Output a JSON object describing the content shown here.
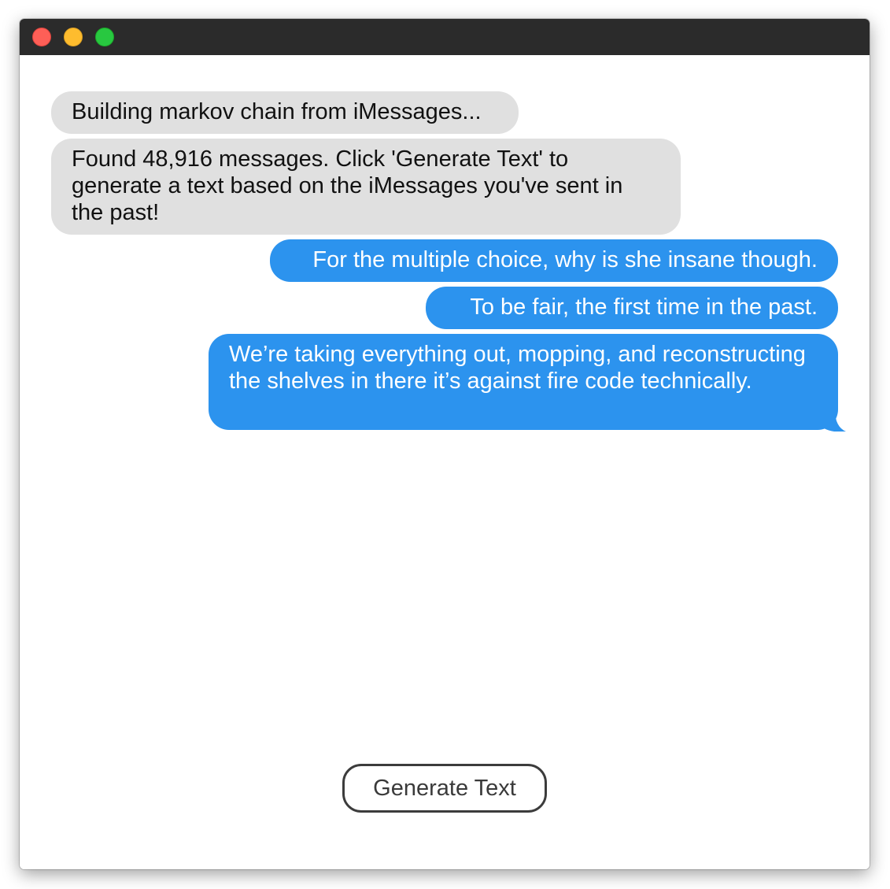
{
  "window": {
    "traffic_lights": {
      "close_color": "#fe5f57",
      "minimize_color": "#febc2e",
      "maximize_color": "#28c840"
    }
  },
  "colors": {
    "received_bubble": "#e0e0e0",
    "sent_bubble": "#2c93ee",
    "titlebar": "#2b2b2b"
  },
  "messages": [
    {
      "direction": "received",
      "text": "Building markov chain from iMessages..."
    },
    {
      "direction": "received",
      "text": "Found 48,916 messages. Click 'Generate Text' to generate a text based on the iMessages you've sent in the past!"
    },
    {
      "direction": "sent",
      "text": "For the multiple choice, why is she insane though."
    },
    {
      "direction": "sent",
      "text": "To be fair, the first time in the past."
    },
    {
      "direction": "sent",
      "text": "We’re taking everything out, mopping, and reconstructing the shelves in there it’s against fire code technically."
    }
  ],
  "generate_button": {
    "label": "Generate Text"
  }
}
